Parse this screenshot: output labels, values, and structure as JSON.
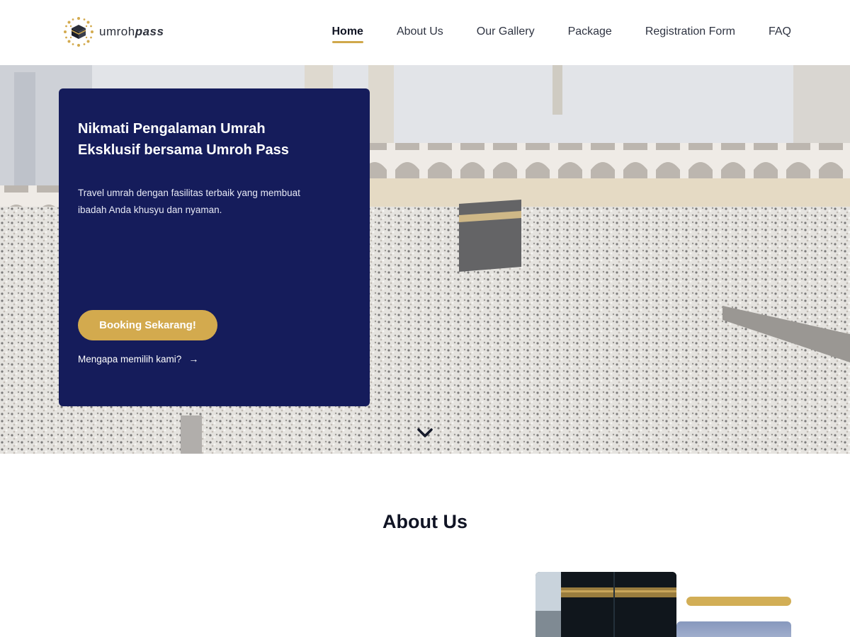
{
  "brand": {
    "name_prefix": "umroh",
    "name_suffix": "pass",
    "logo_icon": "kaaba-sun-logo-icon",
    "accent_color": "#d3aa4e",
    "primary_color": "#151c5b"
  },
  "nav": {
    "items": [
      {
        "label": "Home",
        "active": true
      },
      {
        "label": "About Us",
        "active": false
      },
      {
        "label": "Our Gallery",
        "active": false
      },
      {
        "label": "Package",
        "active": false
      },
      {
        "label": "Registration Form",
        "active": false
      },
      {
        "label": "FAQ",
        "active": false
      }
    ]
  },
  "hero": {
    "title": "Nikmati Pengalaman Umrah Eksklusif bersama Umroh Pass",
    "description": "Travel umrah dengan fasilitas terbaik yang membuat ibadah Anda khusyu dan nyaman.",
    "cta_label": "Booking Sekarang!",
    "secondary_link": "Mengapa memilih kami?",
    "secondary_icon": "arrow-right-icon",
    "scroll_icon": "chevron-down-icon",
    "image": "masjid-al-haram-kaaba-crowd-photo"
  },
  "about": {
    "title": "About Us",
    "image": "kaaba-closeup-photo"
  }
}
